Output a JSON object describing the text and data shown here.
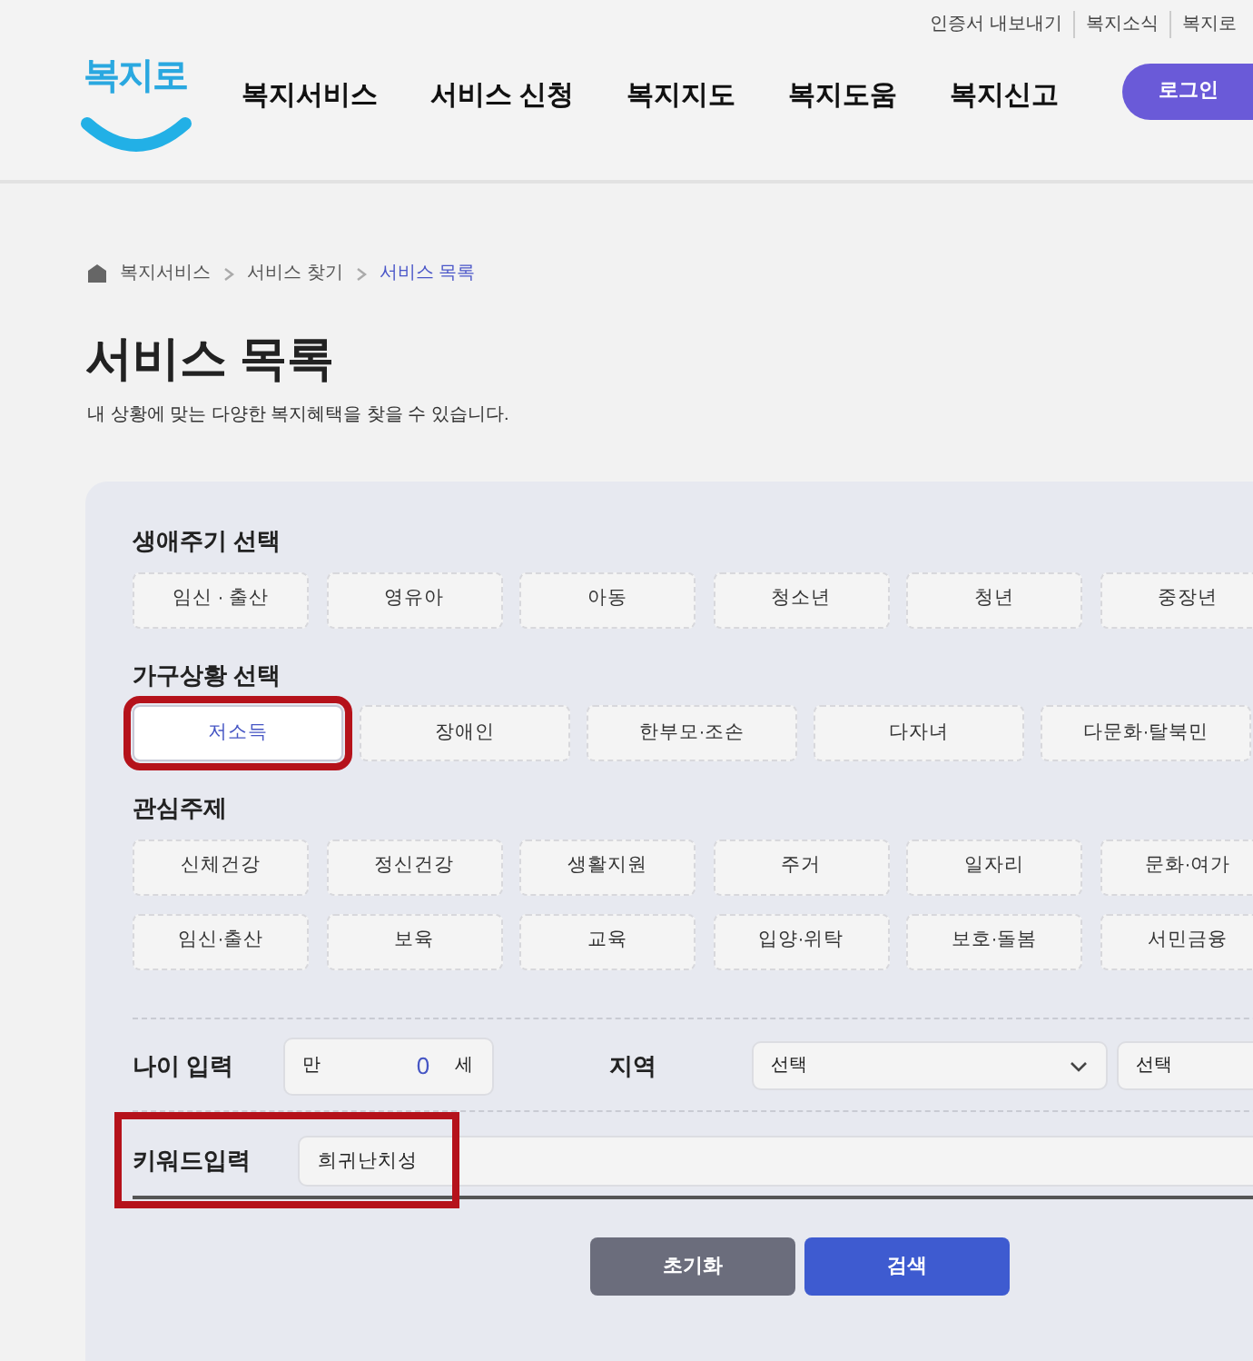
{
  "header": {
    "top_links": [
      "인증서 내보내기",
      "복지소식",
      "복지로"
    ],
    "logo": "복지로",
    "nav": [
      "복지서비스",
      "서비스 신청",
      "복지지도",
      "복지도움",
      "복지신고"
    ],
    "login_button": "로그인"
  },
  "breadcrumb": [
    {
      "label": "복지서비스",
      "current": false
    },
    {
      "label": "서비스 찾기",
      "current": false
    },
    {
      "label": "서비스 목록",
      "current": true
    }
  ],
  "title": "서비스 목록",
  "subtitle": "내 상황에 맞는 다양한 복지혜택을 찾을 수 있습니다.",
  "filters": {
    "lifecycle": {
      "label": "생애주기 선택",
      "chips": [
        {
          "label": "임신 · 출산",
          "selected": false
        },
        {
          "label": "영유아",
          "selected": false
        },
        {
          "label": "아동",
          "selected": false
        },
        {
          "label": "청소년",
          "selected": false
        },
        {
          "label": "청년",
          "selected": false
        },
        {
          "label": "중장년",
          "selected": false
        }
      ]
    },
    "household": {
      "label": "가구상황 선택",
      "chips": [
        {
          "label": "저소득",
          "selected": true,
          "highlighted": true
        },
        {
          "label": "장애인",
          "selected": false,
          "highlighted": false
        },
        {
          "label": "한부모·조손",
          "selected": false,
          "highlighted": false
        },
        {
          "label": "다자녀",
          "selected": false,
          "highlighted": false
        },
        {
          "label": "다문화·탈북민",
          "selected": false,
          "highlighted": false
        }
      ]
    },
    "topics": {
      "label": "관심주제",
      "chips": [
        {
          "label": "신체건강",
          "selected": false
        },
        {
          "label": "정신건강",
          "selected": false
        },
        {
          "label": "생활지원",
          "selected": false
        },
        {
          "label": "주거",
          "selected": false
        },
        {
          "label": "일자리",
          "selected": false
        },
        {
          "label": "문화·여가",
          "selected": false
        },
        {
          "label": "임신·출산",
          "selected": false
        },
        {
          "label": "보육",
          "selected": false
        },
        {
          "label": "교육",
          "selected": false
        },
        {
          "label": "입양·위탁",
          "selected": false
        },
        {
          "label": "보호·돌봄",
          "selected": false
        },
        {
          "label": "서민금융",
          "selected": false
        }
      ]
    },
    "age": {
      "label": "나이 입력",
      "prefix": "만",
      "value": "0",
      "suffix": "세"
    },
    "region": {
      "label": "지역",
      "selects": [
        "선택",
        "선택"
      ]
    },
    "keyword": {
      "label": "키워드입력",
      "value": "희귀난치성",
      "highlighted": true
    }
  },
  "buttons": {
    "reset": "초기화",
    "search": "검색"
  }
}
